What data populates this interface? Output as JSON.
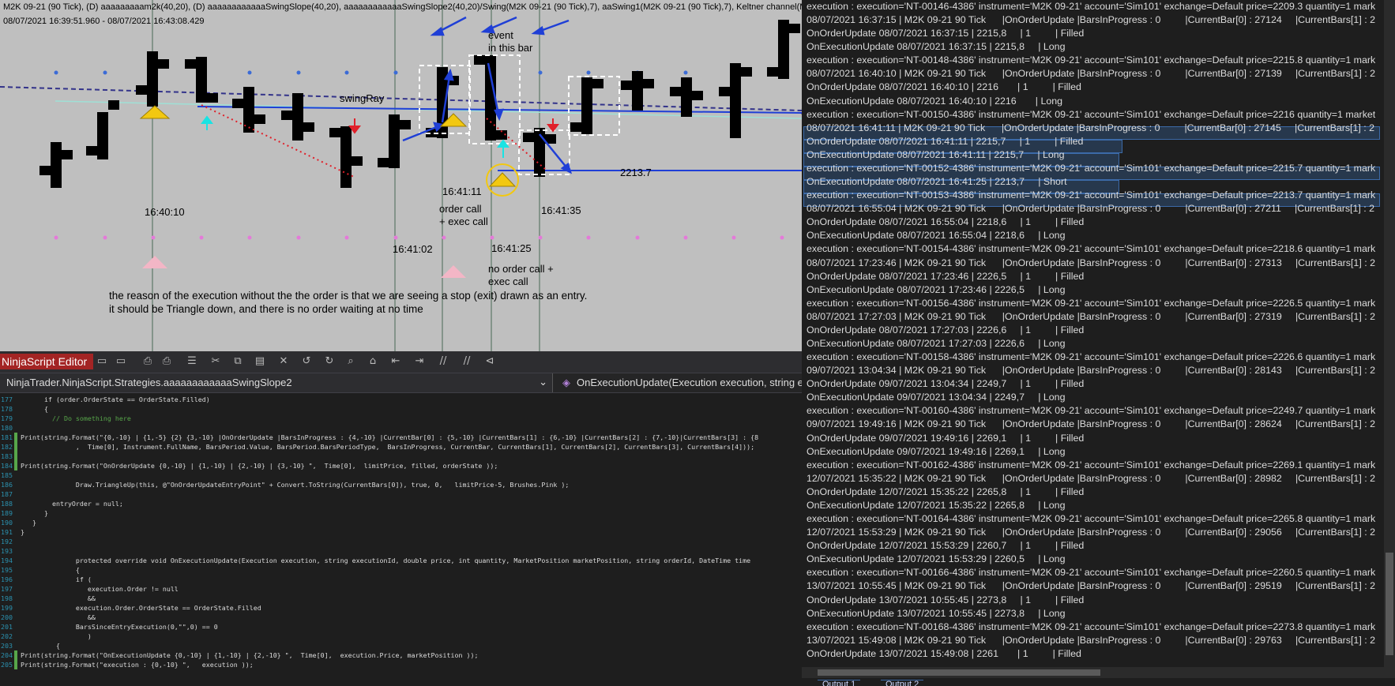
{
  "chart": {
    "title": "M2K 09-21 (90 Tick), (D) aaaaaaaaam2k(40,20), (D) aaaaaaaaaaaaSwingSlope(40,20), aaaaaaaaaaaaSwingSlope2(40,20)/Swing(M2K 09-21 (90 Tick),7), aaSwing1(M2K 09-21 (90 Tick),7), Keltner channel(M2K 09-21",
    "date_range": "08/07/2021 16:39:51.960 - 08/07/2021 16:43:08.429",
    "annotations": {
      "event_line1": "event",
      "event_line2": "in this bar",
      "swing_ray": "swingRay",
      "price_2213": "2213.7",
      "price_221": "221",
      "time_164111": "16:41:11",
      "time_164010": "16:40:10",
      "time_164135": "16:41:35",
      "order_call1": "order call",
      "order_call2": "+ exec call",
      "time_164102": "16:41:02",
      "time_164125": "16:41:25",
      "no_order1": "no order call +",
      "no_order2": "exec call",
      "note1": "the reason of the execution without the the order is that we are seeing a stop (exit) drawn as an entry.",
      "note2": "it should be Triangle down, and there is no order waiting at no time"
    },
    "colors": {
      "background": "#bfbfbf",
      "bars": "#000000",
      "arrows": "#1f3fd6",
      "triangle_up": "#f2c811",
      "pink": "#f3b6c6"
    }
  },
  "editor": {
    "title": "NinjaScript Editor",
    "nav_left": "NinjaTrader.NinjaScript.Strategies.aaaaaaaaaaaaSwingSlope2",
    "nav_right": "OnExecutionUpdate(Execution execution, string exec",
    "toolbar_icons": [
      "save-icon",
      "save-all-icon",
      "print-icon",
      "print-preview-icon",
      "list-icon",
      "cut-icon",
      "copy-icon",
      "paste-icon",
      "delete-icon",
      "undo-icon",
      "redo-icon",
      "find-icon",
      "compile-icon",
      "outdent-icon",
      "indent-icon",
      "comment-icon",
      "uncomment-icon",
      "debug-icon"
    ],
    "lines": [
      {
        "n": "177",
        "t": "      if (order.OrderState == OrderState.Filled)",
        "m": ""
      },
      {
        "n": "178",
        "t": "      {",
        "m": ""
      },
      {
        "n": "179",
        "t": "        // Do something here",
        "m": "",
        "c": "#57a64a"
      },
      {
        "n": "180",
        "t": "",
        "m": ""
      },
      {
        "n": "181",
        "t": "Print(string.Format(\"{0,-10} | {1,-5} {2} {3,-10} |OnOrderUpdate |BarsInProgress : {4,-10} |CurrentBar[0] : {5,-10} |CurrentBars[1] : {6,-10} |CurrentBars[2] : {7,-10}|CurrentBars[3] : {8",
        "m": "g"
      },
      {
        "n": "182",
        "t": "              ,  Time[0], Instrument.FullName, BarsPeriod.Value, BarsPeriod.BarsPeriodType,  BarsInProgress, CurrentBar, CurrentBars[1], CurrentBars[2], CurrentBars[3], CurrentBars[4]));",
        "m": "g"
      },
      {
        "n": "183",
        "t": "",
        "m": "g"
      },
      {
        "n": "184",
        "t": "Print(string.Format(\"OnOrderUpdate {0,-10} | {1,-10} | {2,-10} | {3,-10} \",  Time[0],  limitPrice, filled, orderState ));",
        "m": "g"
      },
      {
        "n": "185",
        "t": "",
        "m": ""
      },
      {
        "n": "186",
        "t": "              Draw.TriangleUp(this, @\"OnOrderUpdateEntryPoint\" + Convert.ToString(CurrentBars[0]), true, 0,   limitPrice-5, Brushes.Pink );",
        "m": ""
      },
      {
        "n": "187",
        "t": "",
        "m": ""
      },
      {
        "n": "188",
        "t": "        entryOrder = null;",
        "m": ""
      },
      {
        "n": "189",
        "t": "      }",
        "m": ""
      },
      {
        "n": "190",
        "t": "   }",
        "m": ""
      },
      {
        "n": "191",
        "t": "}",
        "m": ""
      },
      {
        "n": "192",
        "t": "",
        "m": ""
      },
      {
        "n": "193",
        "t": "",
        "m": ""
      },
      {
        "n": "194",
        "t": "              protected override void OnExecutionUpdate(Execution execution, string executionId, double price, int quantity, MarketPosition marketPosition, string orderId, DateTime time",
        "m": ""
      },
      {
        "n": "195",
        "t": "              {",
        "m": ""
      },
      {
        "n": "196",
        "t": "              if (",
        "m": ""
      },
      {
        "n": "197",
        "t": "                 execution.Order != null",
        "m": ""
      },
      {
        "n": "198",
        "t": "                 &&",
        "m": ""
      },
      {
        "n": "199",
        "t": "              execution.Order.OrderState == OrderState.Filled",
        "m": ""
      },
      {
        "n": "200",
        "t": "                 &&",
        "m": ""
      },
      {
        "n": "201",
        "t": "              BarsSinceEntryExecution(0,\"\",0) == 0",
        "m": ""
      },
      {
        "n": "202",
        "t": "                 )",
        "m": ""
      },
      {
        "n": "203",
        "t": "         {",
        "m": ""
      },
      {
        "n": "204",
        "t": "Print(string.Format(\"OnExecutionUpdate {0,-10} | {1,-10} | {2,-10} \",  Time[0],  execution.Price, marketPosition ));",
        "m": "g"
      },
      {
        "n": "205",
        "t": "Print(string.Format(\"execution : {0,-10} \",   execution ));",
        "m": "g"
      }
    ]
  },
  "output": {
    "lines": [
      "execution : execution='NT-00146-4386' instrument='M2K 09-21' account='Sim101' exchange=Default price=2209.3 quantity=1 mark",
      "08/07/2021 16:37:15 | M2K 09-21 90 Tick      |OnOrderUpdate |BarsInProgress : 0         |CurrentBar[0] : 27124     |CurrentBars[1] : 2",
      "OnOrderUpdate 08/07/2021 16:37:15 | 2215,8     | 1         | Filled",
      "OnExecutionUpdate 08/07/2021 16:37:15 | 2215,8     | Long",
      "execution : execution='NT-00148-4386' instrument='M2K 09-21' account='Sim101' exchange=Default price=2215.8 quantity=1 mark",
      "08/07/2021 16:40:10 | M2K 09-21 90 Tick      |OnOrderUpdate |BarsInProgress : 0         |CurrentBar[0] : 27139     |CurrentBars[1] : 2",
      "OnOrderUpdate 08/07/2021 16:40:10 | 2216       | 1         | Filled",
      "OnExecutionUpdate 08/07/2021 16:40:10 | 2216       | Long",
      "execution : execution='NT-00150-4386' instrument='M2K 09-21' account='Sim101' exchange=Default price=2216 quantity=1 market",
      "08/07/2021 16:41:11 | M2K 09-21 90 Tick      |OnOrderUpdate |BarsInProgress : 0         |CurrentBar[0] : 27145     |CurrentBars[1] : 2",
      "OnOrderUpdate 08/07/2021 16:41:11 | 2215,7     | 1         | Filled",
      "OnExecutionUpdate 08/07/2021 16:41:11 | 2215,7     | Long",
      "execution : execution='NT-00152-4386' instrument='M2K 09-21' account='Sim101' exchange=Default price=2215.7 quantity=1 mark",
      "OnExecutionUpdate 08/07/2021 16:41:25 | 2213,7     | Short",
      "execution : execution='NT-00153-4386' instrument='M2K 09-21' account='Sim101' exchange=Default price=2213.7 quantity=1 mark",
      "08/07/2021 16:55:04 | M2K 09-21 90 Tick      |OnOrderUpdate |BarsInProgress : 0         |CurrentBar[0] : 27211     |CurrentBars[1] : 2",
      "OnOrderUpdate 08/07/2021 16:55:04 | 2218,6     | 1         | Filled",
      "OnExecutionUpdate 08/07/2021 16:55:04 | 2218,6     | Long",
      "execution : execution='NT-00154-4386' instrument='M2K 09-21' account='Sim101' exchange=Default price=2218.6 quantity=1 mark",
      "08/07/2021 17:23:46 | M2K 09-21 90 Tick      |OnOrderUpdate |BarsInProgress : 0         |CurrentBar[0] : 27313     |CurrentBars[1] : 2",
      "OnOrderUpdate 08/07/2021 17:23:46 | 2226,5     | 1         | Filled",
      "OnExecutionUpdate 08/07/2021 17:23:46 | 2226,5     | Long",
      "execution : execution='NT-00156-4386' instrument='M2K 09-21' account='Sim101' exchange=Default price=2226.5 quantity=1 mark",
      "08/07/2021 17:27:03 | M2K 09-21 90 Tick      |OnOrderUpdate |BarsInProgress : 0         |CurrentBar[0] : 27319     |CurrentBars[1] : 2",
      "OnOrderUpdate 08/07/2021 17:27:03 | 2226,6     | 1         | Filled",
      "OnExecutionUpdate 08/07/2021 17:27:03 | 2226,6     | Long",
      "execution : execution='NT-00158-4386' instrument='M2K 09-21' account='Sim101' exchange=Default price=2226.6 quantity=1 mark",
      "09/07/2021 13:04:34 | M2K 09-21 90 Tick      |OnOrderUpdate |BarsInProgress : 0         |CurrentBar[0] : 28143     |CurrentBars[1] : 2",
      "OnOrderUpdate 09/07/2021 13:04:34 | 2249,7     | 1         | Filled",
      "OnExecutionUpdate 09/07/2021 13:04:34 | 2249,7     | Long",
      "execution : execution='NT-00160-4386' instrument='M2K 09-21' account='Sim101' exchange=Default price=2249.7 quantity=1 mark",
      "09/07/2021 19:49:16 | M2K 09-21 90 Tick      |OnOrderUpdate |BarsInProgress : 0         |CurrentBar[0] : 28624     |CurrentBars[1] : 2",
      "OnOrderUpdate 09/07/2021 19:49:16 | 2269,1     | 1         | Filled",
      "OnExecutionUpdate 09/07/2021 19:49:16 | 2269,1     | Long",
      "execution : execution='NT-00162-4386' instrument='M2K 09-21' account='Sim101' exchange=Default price=2269.1 quantity=1 mark",
      "12/07/2021 15:35:22 | M2K 09-21 90 Tick      |OnOrderUpdate |BarsInProgress : 0         |CurrentBar[0] : 28982     |CurrentBars[1] : 2",
      "OnOrderUpdate 12/07/2021 15:35:22 | 2265,8     | 1         | Filled",
      "OnExecutionUpdate 12/07/2021 15:35:22 | 2265,8     | Long",
      "execution : execution='NT-00164-4386' instrument='M2K 09-21' account='Sim101' exchange=Default price=2265.8 quantity=1 mark",
      "12/07/2021 15:53:29 | M2K 09-21 90 Tick      |OnOrderUpdate |BarsInProgress : 0         |CurrentBar[0] : 29056     |CurrentBars[1] : 2",
      "OnOrderUpdate 12/07/2021 15:53:29 | 2260,7     | 1         | Filled",
      "OnExecutionUpdate 12/07/2021 15:53:29 | 2260,5     | Long",
      "execution : execution='NT-00166-4386' instrument='M2K 09-21' account='Sim101' exchange=Default price=2260.5 quantity=1 mark",
      "13/07/2021 10:55:45 | M2K 09-21 90 Tick      |OnOrderUpdate |BarsInProgress : 0         |CurrentBar[0] : 29519     |CurrentBars[1] : 2",
      "OnOrderUpdate 13/07/2021 10:55:45 | 2273,8     | 1         | Filled",
      "OnExecutionUpdate 13/07/2021 10:55:45 | 2273,8     | Long",
      "execution : execution='NT-00168-4386' instrument='M2K 09-21' account='Sim101' exchange=Default price=2273.8 quantity=1 mark",
      "13/07/2021 15:49:08 | M2K 09-21 90 Tick      |OnOrderUpdate |BarsInProgress : 0         |CurrentBar[0] : 29763     |CurrentBars[1] : 2",
      "OnOrderUpdate 13/07/2021 15:49:08 | 2261       | 1         | Filled"
    ],
    "tabs": [
      "Output 1",
      "Output 2"
    ]
  }
}
